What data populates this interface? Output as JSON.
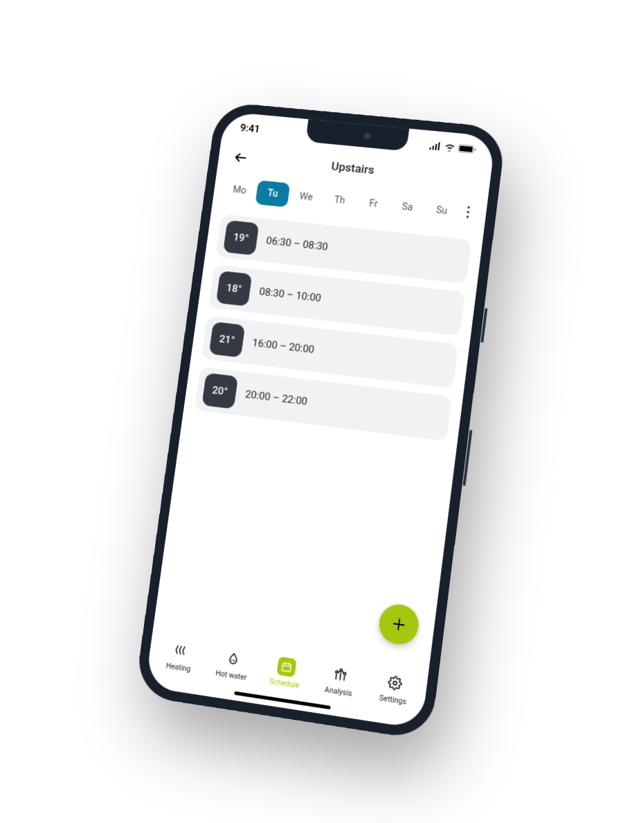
{
  "status": {
    "time": "9:41"
  },
  "header": {
    "title": "Upstairs"
  },
  "days": [
    {
      "label": "Mo",
      "selected": false
    },
    {
      "label": "Tu",
      "selected": true
    },
    {
      "label": "We",
      "selected": false
    },
    {
      "label": "Th",
      "selected": false
    },
    {
      "label": "Fr",
      "selected": false
    },
    {
      "label": "Sa",
      "selected": false
    },
    {
      "label": "Su",
      "selected": false
    }
  ],
  "schedule": [
    {
      "temp": "19°",
      "range": "06:30 – 08:30"
    },
    {
      "temp": "18°",
      "range": "08:30 – 10:00"
    },
    {
      "temp": "21°",
      "range": "16:00 – 20:00"
    },
    {
      "temp": "20°",
      "range": "20:00 – 22:00"
    }
  ],
  "nav": {
    "heating": "Heating",
    "hotwater": "Hot water",
    "schedule": "Schedule",
    "analysis": "Analysis",
    "settings": "Settings"
  },
  "colors": {
    "accent_blue": "#0b7ba3",
    "accent_lime": "#a6c70f",
    "dark": "#343a44"
  }
}
